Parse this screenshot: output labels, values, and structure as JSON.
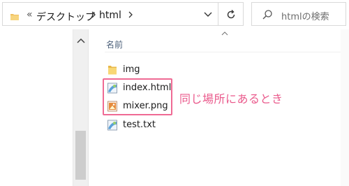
{
  "address_bar": {
    "overflow_glyph": "«",
    "breadcrumbs": [
      "デスクトップ",
      "html"
    ],
    "search_placeholder": "htmlの検索"
  },
  "file_list": {
    "column_header": "名前",
    "items": [
      {
        "name": "img",
        "icon": "folder-icon"
      },
      {
        "name": "index.html",
        "icon": "html-file-icon"
      },
      {
        "name": "mixer.png",
        "icon": "image-file-icon"
      },
      {
        "name": "test.txt",
        "icon": "text-file-icon"
      }
    ]
  },
  "annotation": {
    "text": "同じ場所にあるとき",
    "color": "#ea5a8c"
  }
}
